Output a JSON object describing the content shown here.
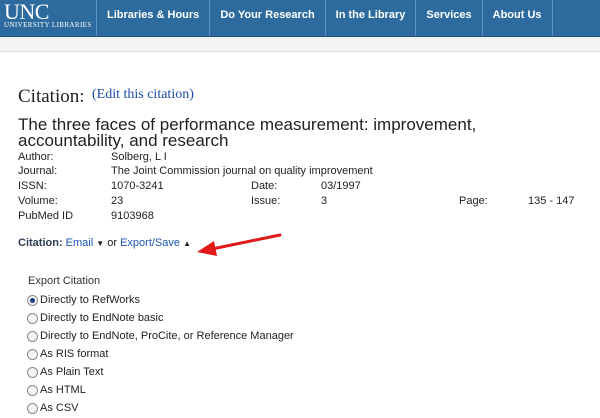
{
  "logo": {
    "main": "UNC",
    "sub": "UNIVERSITY LIBRARIES"
  },
  "nav": [
    "Libraries & Hours",
    "Do Your Research",
    "In the Library",
    "Services",
    "About Us"
  ],
  "citation": {
    "heading": "Citation:",
    "edit_link": "(Edit this citation)",
    "title": "The three faces of performance measurement: improvement, accountability, and research",
    "fields": {
      "author_label": "Author:",
      "author": "Solberg, L I",
      "journal_label": "Journal:",
      "journal": "The Joint Commission journal on quality improvement",
      "issn_label": "ISSN:",
      "issn": "1070-3241",
      "date_label": "Date:",
      "date": "03/1997",
      "volume_label": "Volume:",
      "volume": "23",
      "issue_label": "Issue:",
      "issue": "3",
      "page_label": "Page:",
      "page": "135 - 147",
      "pubmed_label": "PubMed ID",
      "pubmed": "9103968"
    },
    "actions": {
      "label": "Citation:",
      "email": "Email",
      "or": "or",
      "export": "Export/Save"
    }
  },
  "export": {
    "title": "Export Citation",
    "options": [
      {
        "label": "Directly to RefWorks",
        "checked": true
      },
      {
        "label": "Directly to EndNote basic",
        "checked": false
      },
      {
        "label": "Directly to EndNote, ProCite, or Reference Manager",
        "checked": false
      },
      {
        "label": "As RIS format",
        "checked": false
      },
      {
        "label": "As Plain Text",
        "checked": false
      },
      {
        "label": "As HTML",
        "checked": false
      },
      {
        "label": "As CSV",
        "checked": false
      }
    ]
  },
  "colors": {
    "nav_bg": "#2d6b9e",
    "link": "#1a56b4",
    "arrow": "#e01818"
  }
}
